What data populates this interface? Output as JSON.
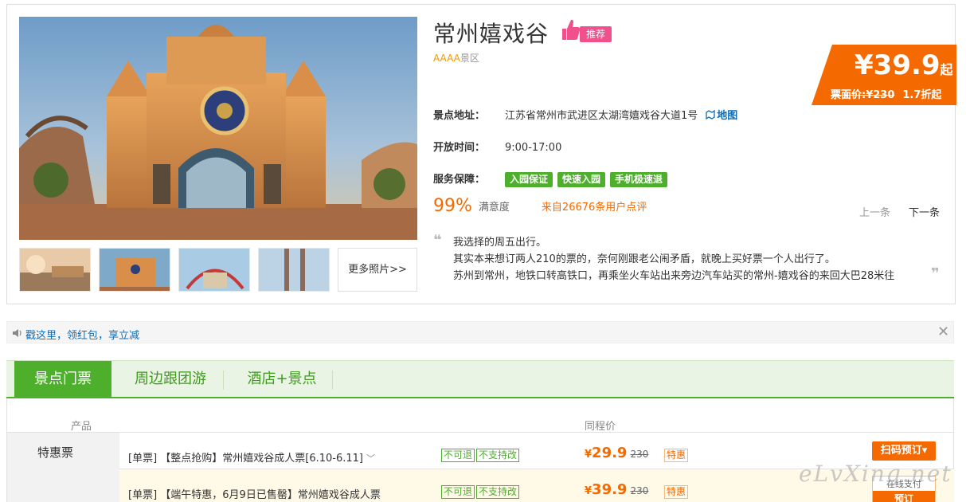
{
  "attraction": {
    "title": "常州嬉戏谷",
    "recommend_tag": "推荐",
    "level_grade": "AAAA",
    "level_suffix": "景区"
  },
  "price": {
    "current": "¥39.9",
    "suffix": "起",
    "face_value": "票面价:¥230",
    "discount": "1.7折起"
  },
  "info": {
    "address_label": "景点地址：",
    "address": "江苏省常州市武进区太湖湾嬉戏谷大道1号",
    "map_link": "地图",
    "hours_label": "开放时间：",
    "hours": "9:00-17:00",
    "service_label": "服务保障：",
    "services": [
      "入园保证",
      "快速入园",
      "手机极速退"
    ]
  },
  "rating": {
    "percent": "99%",
    "label": "满意度",
    "reviews": "来自26676条用户点评",
    "prev": "上一条",
    "next": "下一条"
  },
  "review_quote": {
    "open_mark": "❝",
    "close_mark": "❞",
    "lines": [
      "我选择的周五出行。",
      "其实本来想订两人210的票的，奈何刚跟老公闹矛盾，就晚上买好票一个人出行了。",
      "苏州到常州，地铁口转高铁口，再乘坐火车站出来旁边汽车站买的常州-嬉戏谷的来回大巴28米往"
    ]
  },
  "gallery": {
    "more_label": "更多照片>>"
  },
  "notice": {
    "text": "戳这里，领红包，享立减",
    "close": "✕"
  },
  "tabs": [
    "景点门票",
    "周边跟团游",
    "酒店+景点"
  ],
  "table": {
    "col_product": "产品",
    "col_price": "同程价",
    "category": "特惠票",
    "rows": [
      {
        "name": "[单票] 【整点抢购】常州嬉戏谷成人票[6.10-6.11]",
        "chevron": "﹀",
        "tag1": "不可退",
        "tag2": "不支持改",
        "yen": "¥",
        "price": "29.9",
        "orig": "230",
        "special": "特惠",
        "button": "扫码预订▾"
      },
      {
        "name": "[单票] 【端午特惠，6月9日已售罄】常州嬉戏谷成人票",
        "tag1": "不可退",
        "tag2": "不支持改",
        "yen": "¥",
        "price": "39.9",
        "orig": "230",
        "special": "特惠",
        "pay_label": "在线支付",
        "button": "预订"
      }
    ]
  },
  "watermark": "eLvXing.net",
  "colors": {
    "accent_orange": "#f56a00",
    "green": "#4daf2c",
    "link_blue": "#0f6cb6",
    "pink": "#f0508c"
  }
}
